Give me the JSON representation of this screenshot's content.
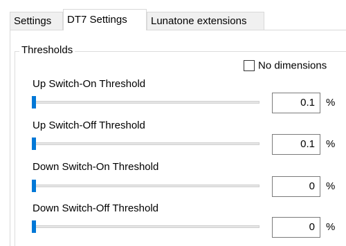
{
  "tabs": [
    {
      "label": "Settings",
      "active": false
    },
    {
      "label": "DT7 Settings",
      "active": true
    },
    {
      "label": "Lunatone extensions",
      "active": false
    }
  ],
  "group": {
    "title": "Thresholds",
    "no_dimensions_label": "No dimensions",
    "no_dimensions_checked": false
  },
  "thresholds": [
    {
      "label": "Up Switch-On Threshold",
      "value": "0.1",
      "unit": "%",
      "slider_fraction": 0.0
    },
    {
      "label": "Up Switch-Off Threshold",
      "value": "0.1",
      "unit": "%",
      "slider_fraction": 0.0
    },
    {
      "label": "Down Switch-On Threshold",
      "value": "0",
      "unit": "%",
      "slider_fraction": 0.0
    },
    {
      "label": "Down Switch-Off Threshold",
      "value": "0",
      "unit": "%",
      "slider_fraction": 0.0
    }
  ],
  "colors": {
    "accent": "#0078d7"
  }
}
